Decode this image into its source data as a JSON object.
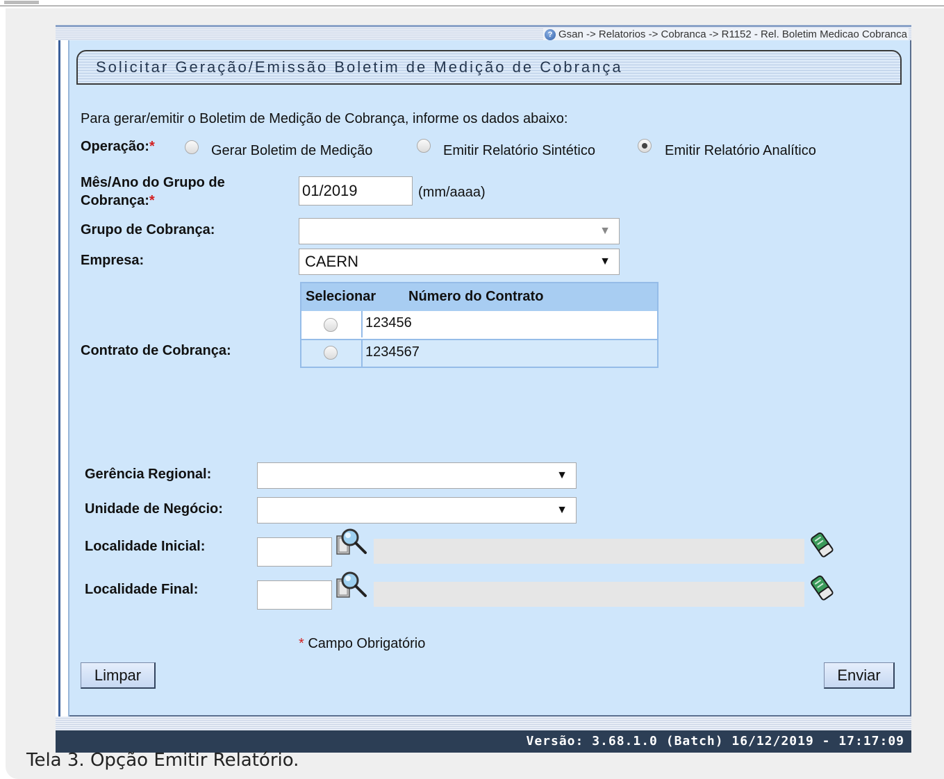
{
  "breadcrumb": "Gsan -> Relatorios -> Cobranca -> R1152 - Rel. Boletim Medicao Cobranca",
  "form": {
    "title": "Solicitar Geração/Emissão Boletim de Medição de Cobrança",
    "instruction": "Para gerar/emitir o Boletim de Medição de Cobrança, informe os dados abaixo:",
    "required_mark": "*",
    "operacao": {
      "label": "Operação:",
      "options": [
        {
          "label": "Gerar Boletim de Medição",
          "checked": false
        },
        {
          "label": "Emitir Relatório Sintético",
          "checked": false
        },
        {
          "label": "Emitir Relatório Analítico",
          "checked": true
        }
      ]
    },
    "mes_ano": {
      "label_line1": "Mês/Ano do Grupo de",
      "label_line2": "Cobrança:",
      "value": "01/2019",
      "hint": "(mm/aaaa)"
    },
    "grupo_cobranca": {
      "label": "Grupo de Cobrança:",
      "value": ""
    },
    "empresa": {
      "label": "Empresa:",
      "value": "CAERN"
    },
    "contrato": {
      "label": "Contrato de Cobrança:",
      "col_select": "Selecionar",
      "col_numero": "Número do Contrato",
      "rows": [
        "123456",
        "1234567"
      ]
    },
    "gerencia_regional": {
      "label": "Gerência Regional:",
      "value": ""
    },
    "unidade_negocio": {
      "label": "Unidade de Negócio:",
      "value": ""
    },
    "localidade_inicial": {
      "label": "Localidade Inicial:",
      "value": "",
      "description": ""
    },
    "localidade_final": {
      "label": "Localidade Final:",
      "value": "",
      "description": ""
    },
    "required_note": "Campo Obrigatório",
    "buttons": {
      "clear": "Limpar",
      "submit": "Enviar"
    }
  },
  "footer": {
    "version": "Versão: 3.68.1.0 (Batch) 16/12/2019 - 17:17:09"
  },
  "caption": "Tela 3. Opção Emitir Relatório."
}
